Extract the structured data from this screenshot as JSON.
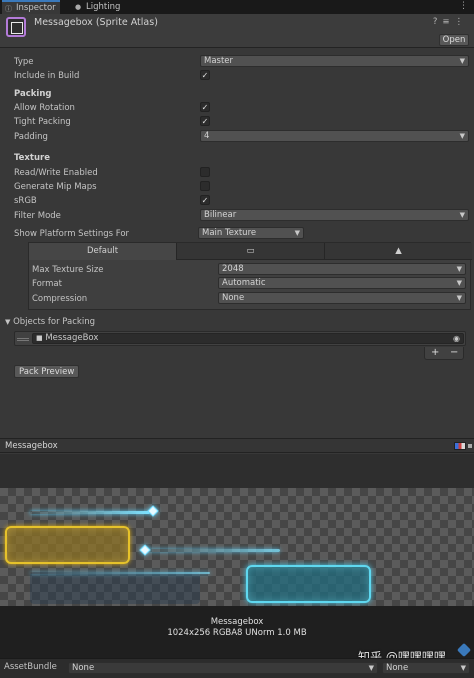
{
  "tabs": [
    {
      "label": "Inspector",
      "icon": "info-icon"
    },
    {
      "label": "Lighting",
      "icon": "bulb-icon"
    }
  ],
  "header": {
    "title": "Messagebox (Sprite Atlas)",
    "open_label": "Open",
    "accent_color": "#b37bd8"
  },
  "fields": {
    "type_label": "Type",
    "type_value": "Master",
    "include_label": "Include in Build",
    "packing_header": "Packing",
    "allow_rotation_label": "Allow Rotation",
    "tight_packing_label": "Tight Packing",
    "padding_label": "Padding",
    "padding_value": "4",
    "texture_header": "Texture",
    "rw_label": "Read/Write Enabled",
    "mip_label": "Generate Mip Maps",
    "srgb_label": "sRGB",
    "filter_label": "Filter Mode",
    "filter_value": "Bilinear",
    "platform_label": "Show Platform Settings For",
    "platform_value": "Main Texture"
  },
  "checkboxes": {
    "include_in_build": true,
    "allow_rotation": true,
    "tight_packing": true,
    "read_write": false,
    "generate_mip_maps": false,
    "srgb": true
  },
  "platform": {
    "default_tab": "Default",
    "max_size_label": "Max Texture Size",
    "max_size_value": "2048",
    "format_label": "Format",
    "format_value": "Automatic",
    "compression_label": "Compression",
    "compression_value": "None"
  },
  "objects": {
    "header": "Objects for Packing",
    "items": [
      "MessageBox"
    ],
    "plus": "+",
    "minus": "−",
    "pack_preview": "Pack Preview"
  },
  "preview": {
    "title": "Messagebox",
    "name": "Messagebox",
    "info": "1024x256 RGBA8 UNorm  1.0 MB"
  },
  "watermark": "知乎 @嘿嘿嘿嘿",
  "asset_bundle": {
    "label": "AssetBundle",
    "value1": "None",
    "value2": "None"
  }
}
